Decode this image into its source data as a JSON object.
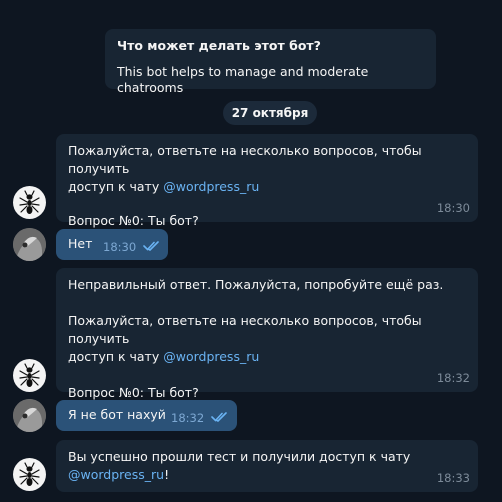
{
  "bot_info": {
    "title": "Что может делать этот бот?",
    "description": "This bot helps to manage and moderate chatrooms"
  },
  "date_separator": "27 октября",
  "messages": [
    {
      "from": "bot",
      "lines": [
        "Пожалуйста, ответьте на несколько вопросов, чтобы получить",
        "доступ к чату "
      ],
      "link": "@wordpress_ru",
      "question": "Вопрос №0: Ты бот?",
      "time": "18:30"
    },
    {
      "from": "user",
      "text": "Нет",
      "time": "18:30",
      "status": "read"
    },
    {
      "from": "bot",
      "error": "Неправильный ответ. Пожалуйста, попробуйте ещё раз.",
      "lines": [
        "Пожалуйста, ответьте на несколько вопросов, чтобы получить",
        "доступ к чату "
      ],
      "link": "@wordpress_ru",
      "question": "Вопрос №0: Ты бот?",
      "time": "18:32"
    },
    {
      "from": "user",
      "text": "Я не бот нахуй",
      "time": "18:32",
      "status": "read"
    },
    {
      "from": "bot",
      "lines": [
        "Вы успешно прошли тест и получили доступ к чату"
      ],
      "link": "@wordpress_ru",
      "suffix": "!",
      "time": "18:33"
    }
  ],
  "colors": {
    "background": "#0e1621",
    "incoming": "#182533",
    "outgoing": "#2b5278",
    "link": "#6ab3f3"
  },
  "icons": {
    "bot_avatar": "ant-icon",
    "user_avatar": "user-photo",
    "read_status": "double-check-icon"
  }
}
